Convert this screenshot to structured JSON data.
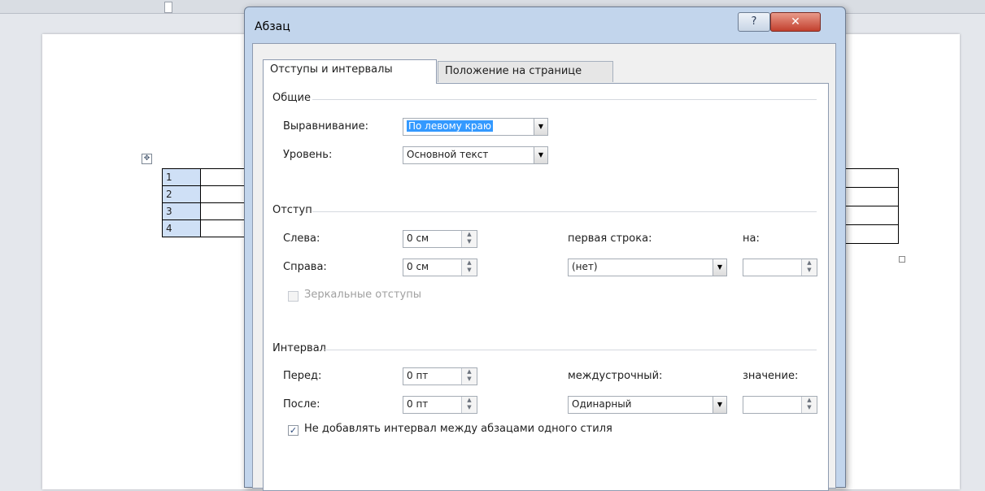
{
  "dialog": {
    "title": "Абзац",
    "help_label": "?",
    "close_label": "✕"
  },
  "tabs": [
    {
      "label": "Отступы и интервалы",
      "active": true
    },
    {
      "label": "Положение на странице",
      "active": false
    }
  ],
  "general": {
    "section_label": "Общие",
    "alignment_label": "Выравнивание:",
    "alignment_value": "По левому краю",
    "level_label": "Уровень:",
    "level_value": "Основной текст"
  },
  "indent": {
    "section_label": "Отступ",
    "left_label": "Слева:",
    "left_value": "0 см",
    "right_label": "Справа:",
    "right_value": "0 см",
    "first_line_label": "первая строка:",
    "first_line_value": "(нет)",
    "by_label": "на:",
    "by_value": "",
    "mirror_label": "Зеркальные отступы",
    "mirror_checked": false
  },
  "spacing": {
    "section_label": "Интервал",
    "before_label": "Перед:",
    "before_value": "0 пт",
    "after_label": "После:",
    "after_value": "0 пт",
    "line_spacing_label": "междустрочный:",
    "line_spacing_value": "Одинарный",
    "at_label": "значение:",
    "at_value": "",
    "no_space_label": "Не добавлять интервал между абзацами одного стиля",
    "no_space_checked": true
  },
  "document": {
    "table_rows": [
      "1",
      "2",
      "3",
      "4"
    ]
  },
  "icons": {
    "dropdown": "▼",
    "spinner_up": "▲",
    "spinner_down": "▼",
    "check": "✓",
    "move": "✥"
  }
}
